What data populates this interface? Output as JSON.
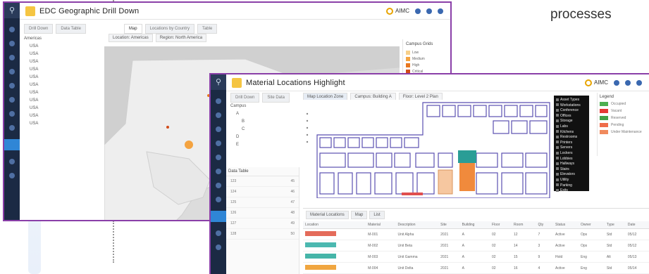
{
  "side_text": "processes",
  "window_map": {
    "title": "EDC Geographic Drill Down",
    "user": "AIMC",
    "tabs": [
      "Drill Down",
      "Data Table",
      "Map",
      "Locations by Country",
      "Table"
    ],
    "filters": [
      "Location: Americas",
      "Region: North America"
    ],
    "tree": [
      "Americas",
      "USA",
      "USA",
      "USA",
      "USA",
      "USA",
      "USA",
      "USA",
      "USA",
      "USA",
      "USA",
      "USA"
    ],
    "legend_title": "Campus Grids",
    "legend": [
      {
        "label": "Low",
        "color": "#f7d08a"
      },
      {
        "label": "Medium",
        "color": "#f4a340"
      },
      {
        "label": "High",
        "color": "#e8761e"
      },
      {
        "label": "Critical",
        "color": "#d24c1a"
      }
    ]
  },
  "window_floor": {
    "title": "Material Locations Highlight",
    "user": "AIMC",
    "tabs": [
      "Drill Down",
      "Site Data"
    ],
    "filters": [
      "Map Location Zone",
      "Campus: Building A",
      "Floor: Level 2 Plan"
    ],
    "tree": [
      "Campus",
      "A",
      "B",
      "C",
      "D",
      "E"
    ],
    "side_header": "Data Table",
    "side_rows": [
      [
        "123",
        "45"
      ],
      [
        "124",
        "46"
      ],
      [
        "125",
        "47"
      ],
      [
        "126",
        "48"
      ],
      [
        "127",
        "49"
      ],
      [
        "128",
        "50"
      ]
    ],
    "context_menu": [
      "Asset Types",
      "Workstations",
      "Conference",
      "Offices",
      "Storage",
      "Labs",
      "Kitchens",
      "Restrooms",
      "Printers",
      "Servers",
      "Lockers",
      "Lobbies",
      "Hallways",
      "Stairs",
      "Elevators",
      "Utility",
      "Parking",
      "Exits"
    ],
    "kpi_title": "Legend",
    "kpi": [
      {
        "label": "Occupied",
        "color": "#4caf50"
      },
      {
        "label": "Vacant",
        "color": "#e53935"
      },
      {
        "label": "Reserved",
        "color": "#43a047"
      },
      {
        "label": "Pending",
        "color": "#ef6c4a"
      },
      {
        "label": "Under Maintenance",
        "color": "#f08a5d"
      }
    ],
    "grid_tabs": [
      "Material Locations",
      "Map",
      "List"
    ],
    "grid_headers": [
      "Location",
      "Material",
      "Description",
      "Site",
      "Building",
      "Floor",
      "Room",
      "Qty",
      "Status",
      "Owner",
      "Type",
      "Date"
    ],
    "grid_rows": [
      {
        "tag": "#e46b5a",
        "cells": [
          "M-001",
          "Unit Alpha",
          "2021",
          "A",
          "02",
          "12",
          "7",
          "Active",
          "Ops",
          "Std",
          "05/12"
        ]
      },
      {
        "tag": "#4bb8b0",
        "cells": [
          "M-002",
          "Unit Beta",
          "2021",
          "A",
          "02",
          "14",
          "3",
          "Active",
          "Ops",
          "Std",
          "05/12"
        ]
      },
      {
        "tag": "#45b5a8",
        "cells": [
          "M-003",
          "Unit Gamma",
          "2021",
          "A",
          "02",
          "15",
          "9",
          "Hold",
          "Eng",
          "Alt",
          "05/13"
        ]
      },
      {
        "tag": "#f0a640",
        "cells": [
          "M-004",
          "Unit Delta",
          "2021",
          "A",
          "02",
          "16",
          "4",
          "Active",
          "Eng",
          "Std",
          "05/14"
        ]
      }
    ]
  }
}
